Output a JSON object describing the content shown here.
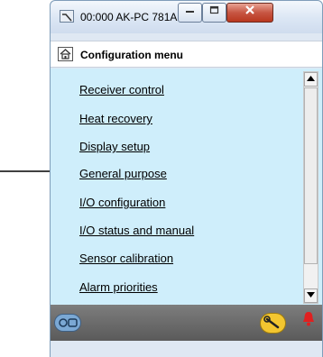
{
  "window": {
    "title": "00:000 AK-PC 781A",
    "icon": "app-icon",
    "buttons": {
      "minimize": "minimize-icon",
      "maximize": "maximize-icon",
      "close": "close-icon"
    }
  },
  "header": {
    "title": "Configuration menu",
    "icon": "home-icon"
  },
  "menu": {
    "items": [
      {
        "label": "Receiver control"
      },
      {
        "label": "Heat recovery"
      },
      {
        "label": "Display setup"
      },
      {
        "label": "General purpose"
      },
      {
        "label": "I/O configuration"
      },
      {
        "label": "I/O status and manual"
      },
      {
        "label": "Sensor calibration"
      },
      {
        "label": "Alarm priorities"
      }
    ]
  },
  "statusbar": {
    "left_icon": "controller-icon",
    "tool_icon": "wrench-icon",
    "alarm_icon": "alarm-bell-icon"
  },
  "colors": {
    "content_bg": "#cfeefb",
    "statusbar_bg": "#6b6b6b",
    "alarm": "#e02020",
    "tool_badge": "#f3c630"
  }
}
